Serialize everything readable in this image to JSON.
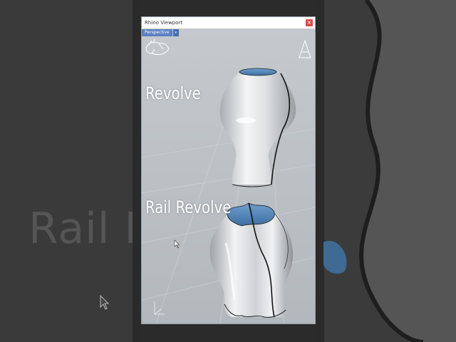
{
  "window": {
    "title": "Rhino Viewport",
    "close_glyph": "×",
    "viewport_tab": "Perspective",
    "dropdown_glyph": "▾"
  },
  "labels": {
    "revolve": "Revolve",
    "rail_revolve": "Rail Revolve"
  },
  "background": {
    "text": "Rail Re"
  },
  "icons": {
    "logo": "rhino-logo-icon",
    "wireframe": "wireframe-a-icon",
    "axes": "xyz-axes-icon",
    "cursor": "mouse-cursor-icon"
  },
  "colors": {
    "viewport_bg": "#bfc3c7",
    "tab_blue": "#5d7fc4",
    "interior_blue": "#4f82b8",
    "close_red": "#e04848"
  }
}
